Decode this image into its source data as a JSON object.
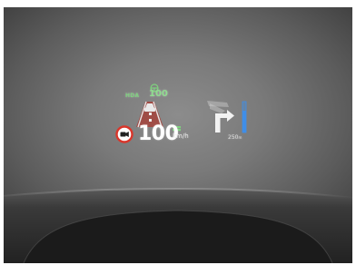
{
  "hud": {
    "hda_label": "HDA",
    "set_speed": "100",
    "current_speed": "100",
    "speed_unit": "km/h",
    "nav_distance": "250",
    "nav_distance_unit": "m",
    "colors": {
      "accent_green": "#7ed27e",
      "warning_red": "#d9362b",
      "nav_blue": "#3f8ee8",
      "text_white": "#ffffff"
    },
    "icons": [
      "hda-steering-icon",
      "lane-road-icon",
      "lead-vehicle-icon",
      "camera-warning-icon",
      "blind-spot-icon",
      "nav-turn-arrow-icon",
      "distance-bar-icon"
    ]
  }
}
